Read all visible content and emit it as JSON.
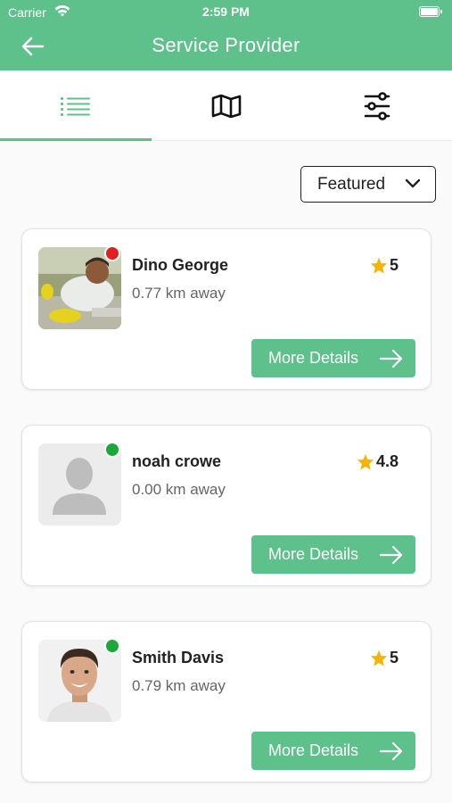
{
  "status_bar": {
    "carrier": "Carrier",
    "time": "2:59 PM"
  },
  "header": {
    "title": "Service Provider",
    "back_icon": "back-arrow-icon"
  },
  "tabs": [
    {
      "icon": "list-icon",
      "active": true
    },
    {
      "icon": "map-icon",
      "active": false
    },
    {
      "icon": "filter-sliders-icon",
      "active": false
    }
  ],
  "sort": {
    "label": "Featured"
  },
  "providers": [
    {
      "name": "Dino George",
      "distance": "0.77 km away",
      "rating": "5",
      "status_color": "#e02020",
      "button_label": "More Details"
    },
    {
      "name": "noah crowe",
      "distance": "0.00 km away",
      "rating": "4.8",
      "status_color": "#1aa83a",
      "button_label": "More Details"
    },
    {
      "name": "Smith Davis",
      "distance": "0.79 km away",
      "rating": "5",
      "status_color": "#1aa83a",
      "button_label": "More Details"
    }
  ],
  "colors": {
    "accent": "#5ec08a",
    "star": "#f5b400"
  }
}
